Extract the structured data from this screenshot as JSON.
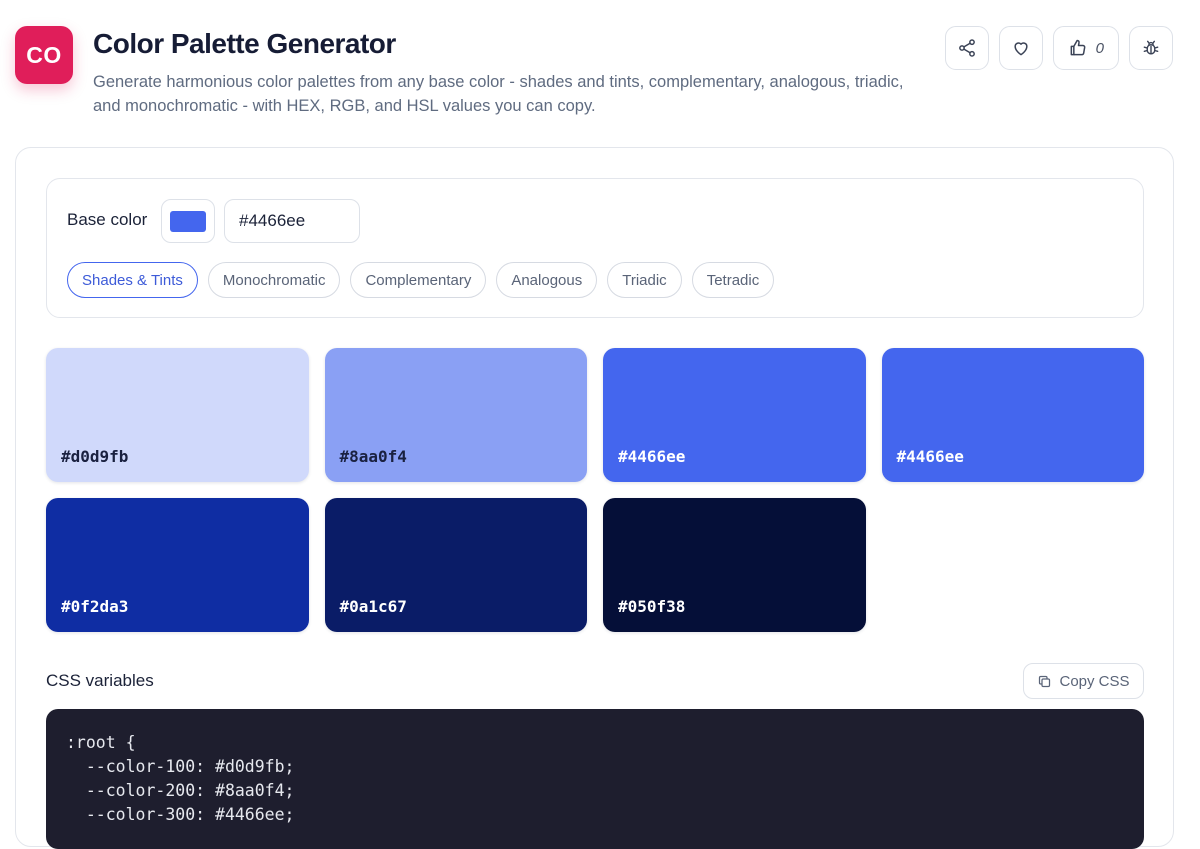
{
  "header": {
    "logo_text": "CO",
    "title": "Color Palette Generator",
    "description": "Generate harmonious color palettes from any base color - shades and tints, complementary, analogous, triadic, and monochromatic - with HEX, RGB, and HSL values you can copy.",
    "actions": [
      {
        "name": "share",
        "icon": "share-icon"
      },
      {
        "name": "favorite",
        "icon": "heart-icon"
      },
      {
        "name": "like",
        "icon": "thumbs-up-icon",
        "count": "0"
      },
      {
        "name": "report-bug",
        "icon": "bug-icon"
      }
    ]
  },
  "controls": {
    "base_label": "Base color",
    "base_hex_value": "#4466ee",
    "base_color": "#4466ee",
    "modes": [
      {
        "label": "Shades & Tints",
        "active": true
      },
      {
        "label": "Monochromatic",
        "active": false
      },
      {
        "label": "Complementary",
        "active": false
      },
      {
        "label": "Analogous",
        "active": false
      },
      {
        "label": "Triadic",
        "active": false
      },
      {
        "label": "Tetradic",
        "active": false
      }
    ]
  },
  "palette": [
    {
      "hex": "#d0d9fb",
      "text_color": "#1a2140"
    },
    {
      "hex": "#8aa0f4",
      "text_color": "#1a2140"
    },
    {
      "hex": "#4466ee",
      "text_color": "#ffffff"
    },
    {
      "hex": "#4466ee",
      "text_color": "#ffffff"
    },
    {
      "hex": "#0f2da3",
      "text_color": "#ffffff"
    },
    {
      "hex": "#0a1c67",
      "text_color": "#ffffff"
    },
    {
      "hex": "#050f38",
      "text_color": "#ffffff"
    }
  ],
  "css_section": {
    "title": "CSS variables",
    "copy_label": "Copy CSS",
    "code_lines": [
      ":root {",
      "  --color-100: #d0d9fb;",
      "  --color-200: #8aa0f4;",
      "  --color-300: #4466ee;"
    ]
  },
  "colors": {
    "accent": "#4466ee",
    "logo_bg": "#e01e5a",
    "code_bg": "#1e1e2e"
  }
}
